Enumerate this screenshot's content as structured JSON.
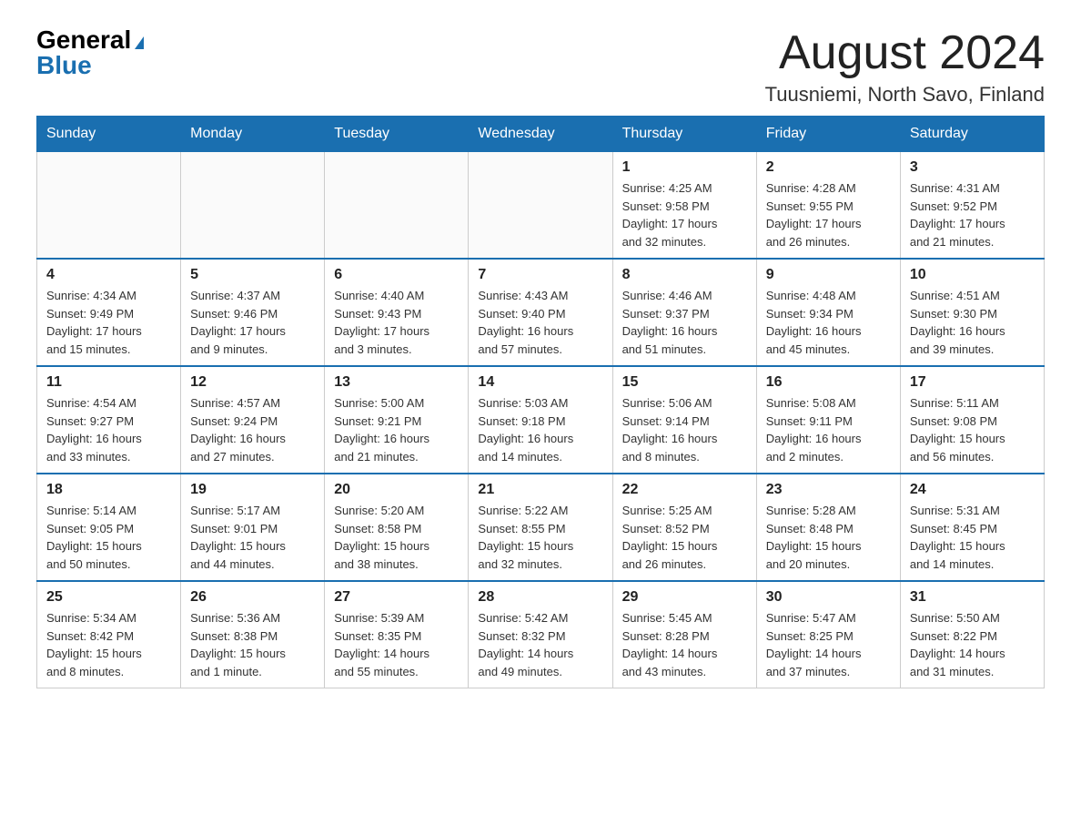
{
  "header": {
    "logo_general": "General",
    "logo_triangle": "▶",
    "logo_blue": "Blue",
    "month_title": "August 2024",
    "location": "Tuusniemi, North Savo, Finland"
  },
  "days_of_week": [
    "Sunday",
    "Monday",
    "Tuesday",
    "Wednesday",
    "Thursday",
    "Friday",
    "Saturday"
  ],
  "weeks": [
    [
      {
        "day": "",
        "info": ""
      },
      {
        "day": "",
        "info": ""
      },
      {
        "day": "",
        "info": ""
      },
      {
        "day": "",
        "info": ""
      },
      {
        "day": "1",
        "info": "Sunrise: 4:25 AM\nSunset: 9:58 PM\nDaylight: 17 hours\nand 32 minutes."
      },
      {
        "day": "2",
        "info": "Sunrise: 4:28 AM\nSunset: 9:55 PM\nDaylight: 17 hours\nand 26 minutes."
      },
      {
        "day": "3",
        "info": "Sunrise: 4:31 AM\nSunset: 9:52 PM\nDaylight: 17 hours\nand 21 minutes."
      }
    ],
    [
      {
        "day": "4",
        "info": "Sunrise: 4:34 AM\nSunset: 9:49 PM\nDaylight: 17 hours\nand 15 minutes."
      },
      {
        "day": "5",
        "info": "Sunrise: 4:37 AM\nSunset: 9:46 PM\nDaylight: 17 hours\nand 9 minutes."
      },
      {
        "day": "6",
        "info": "Sunrise: 4:40 AM\nSunset: 9:43 PM\nDaylight: 17 hours\nand 3 minutes."
      },
      {
        "day": "7",
        "info": "Sunrise: 4:43 AM\nSunset: 9:40 PM\nDaylight: 16 hours\nand 57 minutes."
      },
      {
        "day": "8",
        "info": "Sunrise: 4:46 AM\nSunset: 9:37 PM\nDaylight: 16 hours\nand 51 minutes."
      },
      {
        "day": "9",
        "info": "Sunrise: 4:48 AM\nSunset: 9:34 PM\nDaylight: 16 hours\nand 45 minutes."
      },
      {
        "day": "10",
        "info": "Sunrise: 4:51 AM\nSunset: 9:30 PM\nDaylight: 16 hours\nand 39 minutes."
      }
    ],
    [
      {
        "day": "11",
        "info": "Sunrise: 4:54 AM\nSunset: 9:27 PM\nDaylight: 16 hours\nand 33 minutes."
      },
      {
        "day": "12",
        "info": "Sunrise: 4:57 AM\nSunset: 9:24 PM\nDaylight: 16 hours\nand 27 minutes."
      },
      {
        "day": "13",
        "info": "Sunrise: 5:00 AM\nSunset: 9:21 PM\nDaylight: 16 hours\nand 21 minutes."
      },
      {
        "day": "14",
        "info": "Sunrise: 5:03 AM\nSunset: 9:18 PM\nDaylight: 16 hours\nand 14 minutes."
      },
      {
        "day": "15",
        "info": "Sunrise: 5:06 AM\nSunset: 9:14 PM\nDaylight: 16 hours\nand 8 minutes."
      },
      {
        "day": "16",
        "info": "Sunrise: 5:08 AM\nSunset: 9:11 PM\nDaylight: 16 hours\nand 2 minutes."
      },
      {
        "day": "17",
        "info": "Sunrise: 5:11 AM\nSunset: 9:08 PM\nDaylight: 15 hours\nand 56 minutes."
      }
    ],
    [
      {
        "day": "18",
        "info": "Sunrise: 5:14 AM\nSunset: 9:05 PM\nDaylight: 15 hours\nand 50 minutes."
      },
      {
        "day": "19",
        "info": "Sunrise: 5:17 AM\nSunset: 9:01 PM\nDaylight: 15 hours\nand 44 minutes."
      },
      {
        "day": "20",
        "info": "Sunrise: 5:20 AM\nSunset: 8:58 PM\nDaylight: 15 hours\nand 38 minutes."
      },
      {
        "day": "21",
        "info": "Sunrise: 5:22 AM\nSunset: 8:55 PM\nDaylight: 15 hours\nand 32 minutes."
      },
      {
        "day": "22",
        "info": "Sunrise: 5:25 AM\nSunset: 8:52 PM\nDaylight: 15 hours\nand 26 minutes."
      },
      {
        "day": "23",
        "info": "Sunrise: 5:28 AM\nSunset: 8:48 PM\nDaylight: 15 hours\nand 20 minutes."
      },
      {
        "day": "24",
        "info": "Sunrise: 5:31 AM\nSunset: 8:45 PM\nDaylight: 15 hours\nand 14 minutes."
      }
    ],
    [
      {
        "day": "25",
        "info": "Sunrise: 5:34 AM\nSunset: 8:42 PM\nDaylight: 15 hours\nand 8 minutes."
      },
      {
        "day": "26",
        "info": "Sunrise: 5:36 AM\nSunset: 8:38 PM\nDaylight: 15 hours\nand 1 minute."
      },
      {
        "day": "27",
        "info": "Sunrise: 5:39 AM\nSunset: 8:35 PM\nDaylight: 14 hours\nand 55 minutes."
      },
      {
        "day": "28",
        "info": "Sunrise: 5:42 AM\nSunset: 8:32 PM\nDaylight: 14 hours\nand 49 minutes."
      },
      {
        "day": "29",
        "info": "Sunrise: 5:45 AM\nSunset: 8:28 PM\nDaylight: 14 hours\nand 43 minutes."
      },
      {
        "day": "30",
        "info": "Sunrise: 5:47 AM\nSunset: 8:25 PM\nDaylight: 14 hours\nand 37 minutes."
      },
      {
        "day": "31",
        "info": "Sunrise: 5:50 AM\nSunset: 8:22 PM\nDaylight: 14 hours\nand 31 minutes."
      }
    ]
  ]
}
